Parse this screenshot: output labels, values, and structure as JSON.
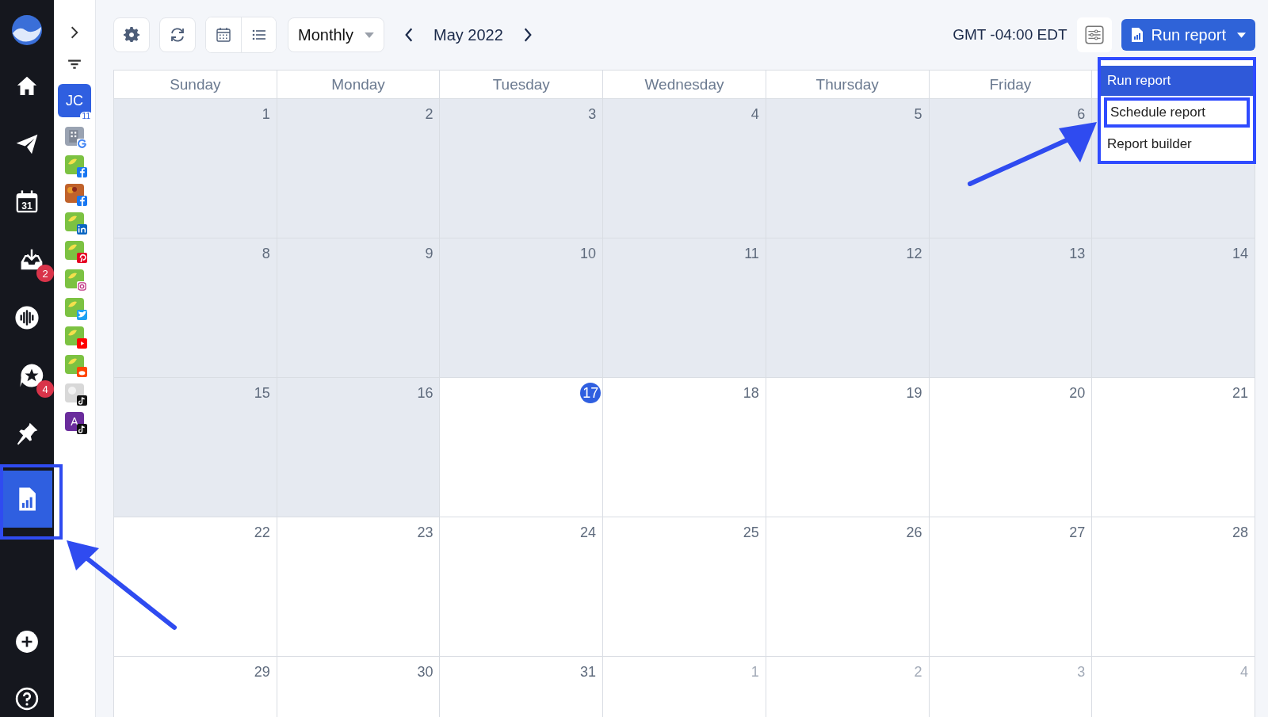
{
  "nav": {
    "items": [
      {
        "kind": "home",
        "selected": false
      },
      {
        "kind": "send",
        "selected": false
      },
      {
        "kind": "calendar",
        "selected": false,
        "icon_text": "31"
      },
      {
        "kind": "inbox",
        "selected": false,
        "badge": "2"
      },
      {
        "kind": "listening",
        "selected": false
      },
      {
        "kind": "reviews",
        "selected": false,
        "badge": "4"
      },
      {
        "kind": "pin",
        "selected": false
      },
      {
        "kind": "reports",
        "selected": true
      }
    ],
    "bottom": [
      {
        "kind": "add"
      },
      {
        "kind": "help"
      }
    ]
  },
  "profiles": {
    "group": {
      "initials": "JC",
      "count": "11"
    },
    "accounts": [
      {
        "kind": "building",
        "color": "#9aa3b2",
        "badge": {
          "kind": "google"
        }
      },
      {
        "kind": "logo",
        "color": "#7cc242",
        "badge": {
          "kind": "facebook"
        }
      },
      {
        "kind": "photo",
        "color": "#c0622b",
        "badge": {
          "kind": "facebook"
        }
      },
      {
        "kind": "logo",
        "color": "#7cc242",
        "badge": {
          "kind": "linkedin"
        }
      },
      {
        "kind": "logo",
        "color": "#7cc242",
        "badge": {
          "kind": "pinterest"
        }
      },
      {
        "kind": "logo",
        "color": "#7cc242",
        "badge": {
          "kind": "instagram"
        }
      },
      {
        "kind": "logo",
        "color": "#7cc242",
        "badge": {
          "kind": "twitter"
        }
      },
      {
        "kind": "logo",
        "color": "#7cc242",
        "badge": {
          "kind": "youtube"
        }
      },
      {
        "kind": "logo",
        "color": "#7cc242",
        "badge": {
          "kind": "reddit"
        }
      },
      {
        "kind": "blank",
        "color": "#d8d8d8",
        "badge": {
          "kind": "tiktok"
        }
      },
      {
        "kind": "letter",
        "color": "#6a2c9c",
        "letter": "A",
        "badge": {
          "kind": "tiktok"
        }
      }
    ]
  },
  "toolbar": {
    "view_mode": "Monthly",
    "period": "May 2022",
    "timezone": "GMT -04:00 EDT",
    "run_button": "Run report",
    "views": [
      {
        "kind": "calendar",
        "selected": false
      },
      {
        "kind": "list",
        "selected": false
      }
    ]
  },
  "menu": [
    {
      "label": "Run report",
      "selected": true,
      "highlighted": false
    },
    {
      "label": "Schedule report",
      "selected": false,
      "highlighted": true
    },
    {
      "label": "Report builder",
      "selected": false,
      "highlighted": false
    }
  ],
  "calendar": {
    "weekdays": [
      "Sunday",
      "Monday",
      "Tuesday",
      "Wednesday",
      "Thursday",
      "Friday"
    ],
    "weeks": [
      {
        "days": [
          {
            "label": "1",
            "past": true
          },
          {
            "label": "2",
            "past": true
          },
          {
            "label": "3",
            "past": true
          },
          {
            "label": "4",
            "past": true
          },
          {
            "label": "5",
            "past": true
          },
          {
            "label": "6",
            "past": true
          },
          {
            "past": true
          }
        ]
      },
      {
        "days": [
          {
            "label": "8",
            "past": true
          },
          {
            "label": "9",
            "past": true
          },
          {
            "label": "10",
            "past": true
          },
          {
            "label": "11",
            "past": true
          },
          {
            "label": "12",
            "past": true
          },
          {
            "label": "13",
            "past": true
          },
          {
            "label": "14",
            "past": true
          }
        ]
      },
      {
        "days": [
          {
            "label": "15",
            "past": true
          },
          {
            "label": "16",
            "past": true
          },
          {
            "label": "17",
            "past": false,
            "today": true
          },
          {
            "label": "18",
            "past": false
          },
          {
            "label": "19",
            "past": false
          },
          {
            "label": "20",
            "past": false
          },
          {
            "label": "21",
            "past": false
          }
        ]
      },
      {
        "days": [
          {
            "label": "22",
            "past": false
          },
          {
            "label": "23",
            "past": false
          },
          {
            "label": "24",
            "past": false
          },
          {
            "label": "25",
            "past": false
          },
          {
            "label": "26",
            "past": false
          },
          {
            "label": "27",
            "past": false
          },
          {
            "label": "28",
            "past": false
          }
        ]
      },
      {
        "days": [
          {
            "label": "29",
            "past": false
          },
          {
            "label": "30",
            "past": false
          },
          {
            "label": "31",
            "past": false
          },
          {
            "label": "1",
            "past": false,
            "other_month": true
          },
          {
            "label": "2",
            "past": false,
            "other_month": true
          },
          {
            "label": "3",
            "past": false,
            "other_month": true
          },
          {
            "label": "4",
            "past": false,
            "other_month": true
          }
        ]
      }
    ]
  }
}
